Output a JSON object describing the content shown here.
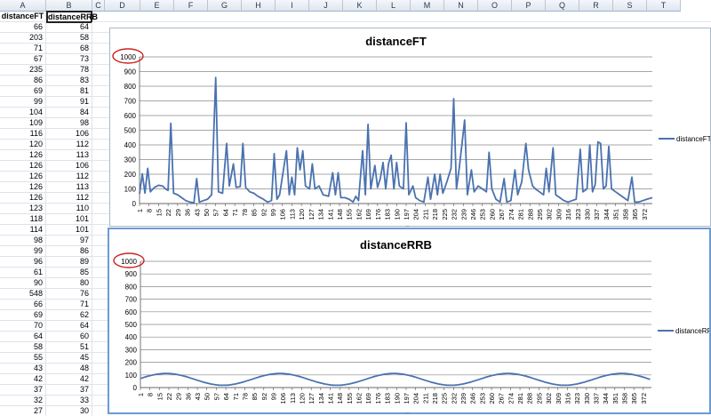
{
  "spreadsheet": {
    "columns": [
      "A",
      "B",
      "C",
      "D",
      "E",
      "F",
      "G",
      "H",
      "I",
      "J",
      "K",
      "L",
      "M",
      "N",
      "O",
      "P",
      "Q",
      "R",
      "S",
      "T"
    ],
    "headers": [
      "distanceFT",
      "distanceRRB"
    ],
    "colA": [
      66,
      203,
      71,
      67,
      235,
      86,
      69,
      99,
      104,
      109,
      116,
      120,
      126,
      126,
      126,
      126,
      126,
      123,
      118,
      114,
      98,
      99,
      96,
      61,
      90,
      548,
      66,
      69,
      70,
      64,
      58,
      55,
      43,
      42,
      37,
      32,
      27
    ],
    "colB": [
      64,
      58,
      68,
      73,
      78,
      83,
      81,
      91,
      84,
      98,
      106,
      112,
      113,
      106,
      112,
      113,
      112,
      110,
      101,
      101,
      97,
      86,
      89,
      85,
      80,
      76,
      71,
      62,
      64,
      60,
      51,
      45,
      48,
      42,
      37,
      33,
      30
    ]
  },
  "charts": [
    {
      "title": "distanceFT",
      "legend": "distanceFT",
      "highlight": "1000",
      "yticks": [
        "1000",
        "900",
        "800",
        "700",
        "600",
        "500",
        "400",
        "300",
        "200",
        "100",
        "0"
      ],
      "xticks": [
        "1",
        "8",
        "15",
        "22",
        "29",
        "36",
        "43",
        "50",
        "57",
        "64",
        "71",
        "78",
        "85",
        "92",
        "99",
        "106",
        "113",
        "120",
        "127",
        "134",
        "141",
        "148",
        "155",
        "162",
        "169",
        "176",
        "183",
        "190",
        "197",
        "204",
        "211",
        "218",
        "225",
        "232",
        "239",
        "246",
        "253",
        "260",
        "267",
        "274",
        "281",
        "288",
        "295",
        "302",
        "309",
        "316",
        "323",
        "330",
        "337",
        "344",
        "351",
        "358",
        "365",
        "372"
      ]
    },
    {
      "title": "distanceRRB",
      "legend": "distanceRRB",
      "highlight": "1000",
      "yticks": [
        "1000",
        "900",
        "800",
        "700",
        "600",
        "500",
        "400",
        "300",
        "200",
        "100",
        "0"
      ],
      "xticks": [
        "1",
        "8",
        "15",
        "22",
        "29",
        "36",
        "43",
        "50",
        "57",
        "64",
        "71",
        "78",
        "85",
        "92",
        "99",
        "106",
        "113",
        "120",
        "127",
        "134",
        "141",
        "148",
        "155",
        "162",
        "169",
        "176",
        "183",
        "190",
        "197",
        "204",
        "211",
        "218",
        "225",
        "232",
        "239",
        "246",
        "253",
        "260",
        "267",
        "274",
        "281",
        "288",
        "295",
        "302",
        "309",
        "316",
        "323",
        "330",
        "337",
        "344",
        "351",
        "358",
        "365",
        "372"
      ]
    }
  ],
  "colors": {
    "series": "#4a72b0",
    "header": "#dfe6ef",
    "highlight": "#cc2222"
  },
  "chart_data": [
    {
      "type": "line",
      "title": "distanceFT",
      "ylim": [
        0,
        1000
      ],
      "grid": true,
      "legend": "right",
      "x": [
        1,
        378
      ],
      "series": [
        {
          "name": "distanceFT",
          "points": [
            [
              1,
              66
            ],
            [
              3,
              203
            ],
            [
              5,
              71
            ],
            [
              7,
              240
            ],
            [
              9,
              80
            ],
            [
              12,
              110
            ],
            [
              15,
              125
            ],
            [
              18,
              120
            ],
            [
              20,
              100
            ],
            [
              22,
              90
            ],
            [
              24,
              548
            ],
            [
              26,
              70
            ],
            [
              29,
              60
            ],
            [
              32,
              40
            ],
            [
              35,
              20
            ],
            [
              38,
              10
            ],
            [
              41,
              5
            ],
            [
              43,
              170
            ],
            [
              45,
              10
            ],
            [
              48,
              20
            ],
            [
              51,
              30
            ],
            [
              54,
              60
            ],
            [
              57,
              860
            ],
            [
              59,
              80
            ],
            [
              62,
              70
            ],
            [
              65,
              410
            ],
            [
              67,
              120
            ],
            [
              70,
              270
            ],
            [
              72,
              110
            ],
            [
              75,
              115
            ],
            [
              77,
              410
            ],
            [
              79,
              110
            ],
            [
              82,
              80
            ],
            [
              85,
              70
            ],
            [
              88,
              50
            ],
            [
              92,
              30
            ],
            [
              95,
              10
            ],
            [
              98,
              20
            ],
            [
              100,
              340
            ],
            [
              102,
              30
            ],
            [
              104,
              60
            ],
            [
              107,
              240
            ],
            [
              109,
              360
            ],
            [
              111,
              60
            ],
            [
              113,
              180
            ],
            [
              115,
              60
            ],
            [
              117,
              380
            ],
            [
              119,
              230
            ],
            [
              121,
              360
            ],
            [
              123,
              120
            ],
            [
              126,
              100
            ],
            [
              128,
              270
            ],
            [
              130,
              100
            ],
            [
              133,
              120
            ],
            [
              136,
              60
            ],
            [
              140,
              50
            ],
            [
              143,
              210
            ],
            [
              145,
              60
            ],
            [
              147,
              210
            ],
            [
              149,
              40
            ],
            [
              152,
              40
            ],
            [
              155,
              30
            ],
            [
              158,
              10
            ],
            [
              160,
              50
            ],
            [
              162,
              20
            ],
            [
              165,
              360
            ],
            [
              167,
              60
            ],
            [
              169,
              540
            ],
            [
              171,
              100
            ],
            [
              174,
              260
            ],
            [
              176,
              110
            ],
            [
              178,
              170
            ],
            [
              180,
              280
            ],
            [
              182,
              100
            ],
            [
              184,
              270
            ],
            [
              186,
              330
            ],
            [
              188,
              100
            ],
            [
              190,
              280
            ],
            [
              192,
              120
            ],
            [
              195,
              100
            ],
            [
              197,
              550
            ],
            [
              199,
              60
            ],
            [
              202,
              120
            ],
            [
              204,
              40
            ],
            [
              207,
              20
            ],
            [
              210,
              10
            ],
            [
              213,
              180
            ],
            [
              215,
              30
            ],
            [
              218,
              200
            ],
            [
              220,
              60
            ],
            [
              222,
              200
            ],
            [
              224,
              70
            ],
            [
              227,
              150
            ],
            [
              230,
              240
            ],
            [
              232,
              715
            ],
            [
              234,
              100
            ],
            [
              236,
              240
            ],
            [
              238,
              400
            ],
            [
              240,
              570
            ],
            [
              242,
              60
            ],
            [
              245,
              230
            ],
            [
              247,
              80
            ],
            [
              250,
              120
            ],
            [
              253,
              100
            ],
            [
              256,
              80
            ],
            [
              258,
              350
            ],
            [
              260,
              100
            ],
            [
              263,
              30
            ],
            [
              266,
              10
            ],
            [
              269,
              170
            ],
            [
              271,
              10
            ],
            [
              274,
              20
            ],
            [
              277,
              230
            ],
            [
              279,
              60
            ],
            [
              282,
              150
            ],
            [
              285,
              410
            ],
            [
              287,
              230
            ],
            [
              290,
              120
            ],
            [
              292,
              100
            ],
            [
              295,
              80
            ],
            [
              298,
              60
            ],
            [
              300,
              240
            ],
            [
              302,
              80
            ],
            [
              305,
              380
            ],
            [
              307,
              60
            ],
            [
              310,
              40
            ],
            [
              313,
              20
            ],
            [
              316,
              10
            ],
            [
              319,
              20
            ],
            [
              322,
              30
            ],
            [
              325,
              370
            ],
            [
              327,
              80
            ],
            [
              330,
              100
            ],
            [
              332,
              400
            ],
            [
              334,
              80
            ],
            [
              336,
              130
            ],
            [
              338,
              420
            ],
            [
              340,
              410
            ],
            [
              342,
              100
            ],
            [
              344,
              120
            ],
            [
              346,
              390
            ],
            [
              348,
              100
            ],
            [
              351,
              80
            ],
            [
              354,
              60
            ],
            [
              357,
              40
            ],
            [
              360,
              20
            ],
            [
              363,
              180
            ],
            [
              365,
              10
            ],
            [
              368,
              10
            ],
            [
              371,
              20
            ],
            [
              374,
              30
            ],
            [
              378,
              40
            ]
          ]
        }
      ]
    },
    {
      "type": "line",
      "title": "distanceRRB",
      "ylim": [
        0,
        1000
      ],
      "grid": true,
      "legend": "right",
      "x": [
        1,
        378
      ],
      "series": [
        {
          "name": "distanceRRB",
          "period": 84,
          "min": 18,
          "max": 112,
          "first_peak_x": 20
        }
      ]
    }
  ]
}
